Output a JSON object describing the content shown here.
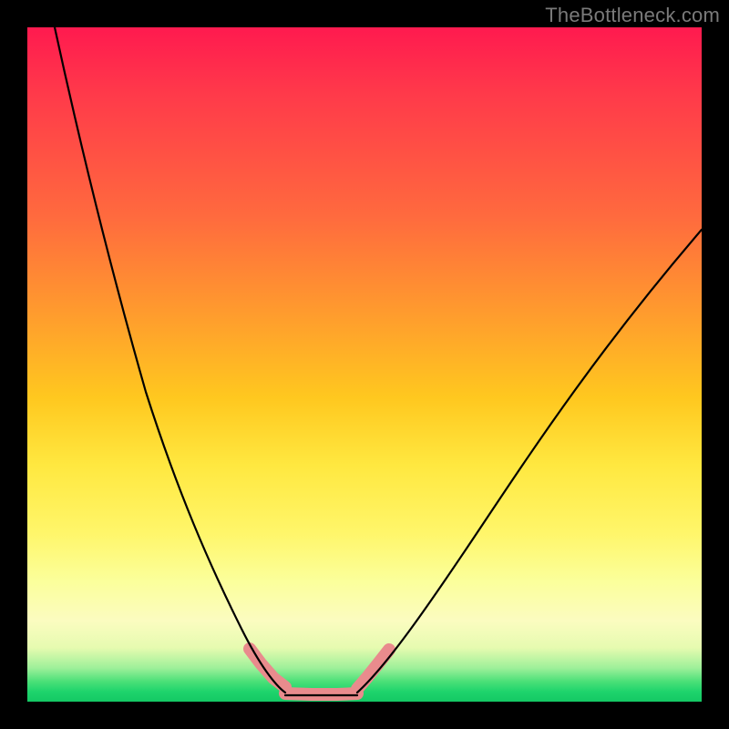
{
  "watermark": "TheBottleneck.com",
  "colors": {
    "background": "#000000",
    "gradient_top": "#ff1a4f",
    "gradient_bottom": "#14c864",
    "curve": "#000000",
    "highlight": "#e98b8d"
  },
  "chart_data": {
    "type": "line",
    "title": "",
    "xlabel": "",
    "ylabel": "",
    "xlim": [
      0,
      100
    ],
    "ylim": [
      0,
      100
    ],
    "series": [
      {
        "name": "left-curve",
        "x": [
          4,
          8,
          12,
          16,
          20,
          24,
          28,
          32,
          35,
          37,
          38
        ],
        "values": [
          100,
          80,
          62,
          46,
          33,
          22,
          14,
          8,
          4,
          2,
          1
        ]
      },
      {
        "name": "flat-bottom",
        "x": [
          38,
          42,
          46,
          49
        ],
        "values": [
          0.5,
          0.5,
          0.5,
          0.5
        ]
      },
      {
        "name": "right-curve",
        "x": [
          49,
          55,
          62,
          70,
          78,
          86,
          94,
          100
        ],
        "values": [
          1,
          6,
          15,
          26,
          38,
          50,
          62,
          70
        ]
      }
    ],
    "highlight_segments": [
      {
        "name": "left-pink",
        "x": [
          33,
          35,
          37,
          38
        ],
        "values": [
          6,
          4,
          2,
          1
        ]
      },
      {
        "name": "bottom-pink",
        "x": [
          38,
          42,
          46,
          49
        ],
        "values": [
          0.5,
          0.5,
          0.5,
          0.5
        ]
      },
      {
        "name": "right-pink",
        "x": [
          49,
          50.5,
          52,
          53.5
        ],
        "values": [
          1,
          3,
          5,
          7
        ]
      }
    ]
  }
}
